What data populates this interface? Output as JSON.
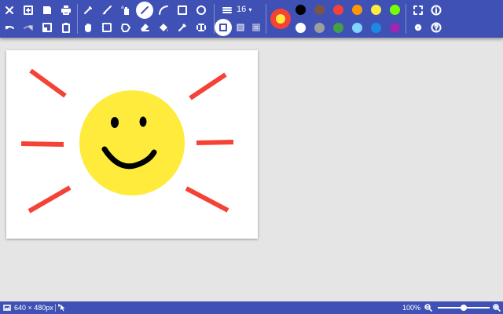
{
  "toolbar": {
    "brush_size": "16",
    "brush_size_caret": "▾",
    "current_color": {
      "stroke": "#f44336",
      "fill": "#ffeb3b"
    },
    "palette": [
      {
        "name": "black",
        "hex": "#000000"
      },
      {
        "name": "brown",
        "hex": "#795548"
      },
      {
        "name": "red",
        "hex": "#f44336"
      },
      {
        "name": "orange",
        "hex": "#ff9800"
      },
      {
        "name": "yellow",
        "hex": "#ffeb3b"
      },
      {
        "name": "lime",
        "hex": "#76ff03"
      },
      {
        "name": "white",
        "hex": "#ffffff"
      },
      {
        "name": "grey",
        "hex": "#9e9e9e"
      },
      {
        "name": "green",
        "hex": "#43a047"
      },
      {
        "name": "light-blue",
        "hex": "#81d4fa"
      },
      {
        "name": "blue",
        "hex": "#1e88e5"
      },
      {
        "name": "purple",
        "hex": "#9c27b0"
      }
    ],
    "accent": "#3f51b5"
  },
  "drawing": {
    "sun_color": "#ffeb3b",
    "ray_color": "#f44336",
    "face_color": "#000000"
  },
  "status": {
    "canvas_size": "640 × 480px",
    "zoom": "100%",
    "zoom_fraction": 0.5
  }
}
